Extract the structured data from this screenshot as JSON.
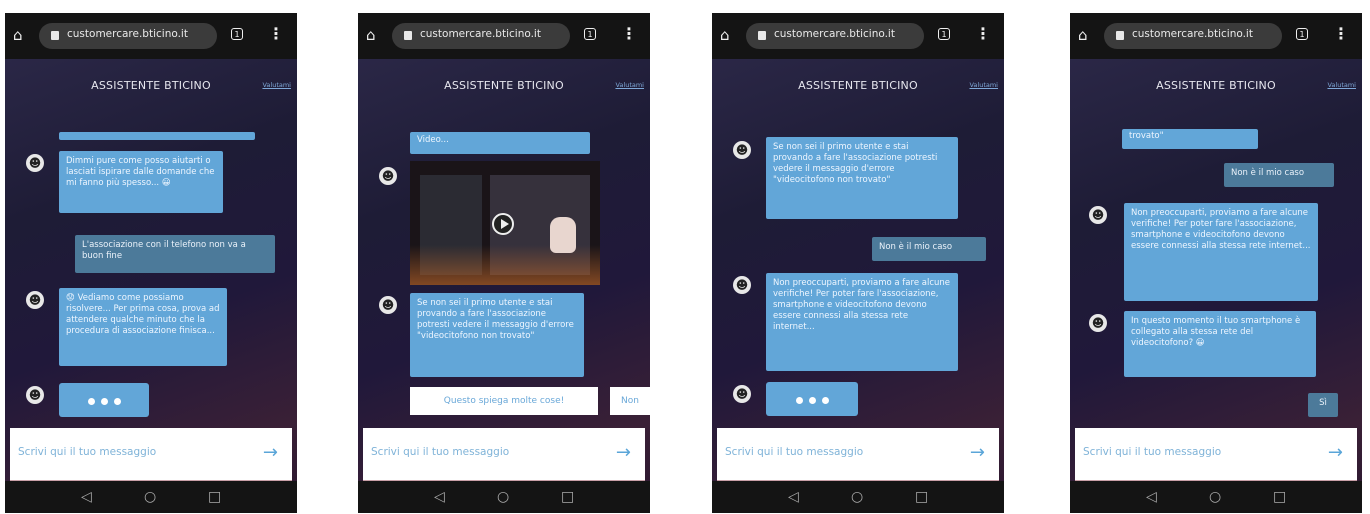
{
  "browser": {
    "url": "customercare.bticino.it",
    "tab_count": "1",
    "menu_icon": "⋮",
    "home_icon": "⌂"
  },
  "header": {
    "title": "ASSISTENTE BTICINO",
    "rate_link": "Valutami"
  },
  "composer": {
    "placeholder": "Scrivi qui il tuo messaggio",
    "send_icon": "→"
  },
  "navbar": {
    "back": "◁",
    "home": "○",
    "recents": "□"
  },
  "screens": [
    {
      "messages": [
        {
          "from": "bot",
          "text": "Dimmi pure come posso aiutarti o lasciati ispirare dalle domande che mi fanno più spesso... 😀"
        },
        {
          "from": "user",
          "text": "L'associazione con il telefono non va a buon fine"
        },
        {
          "from": "bot",
          "text": "😟 Vediamo come possiamo risolvere... Per prima cosa, prova ad attendere qualche minuto che la procedura di associazione finisca..."
        }
      ]
    },
    {
      "messages": [
        {
          "from": "bot",
          "text": "Video..."
        },
        {
          "from": "bot",
          "text": "Se non sei il primo utente e stai provando a fare l'associazione potresti vedere il messaggio d'errore \"videocitofono non trovato\""
        }
      ],
      "chips": [
        "Questo spiega molte cose!",
        "Non"
      ]
    },
    {
      "messages": [
        {
          "from": "bot",
          "text": "Se non sei il primo utente e stai provando a fare l'associazione potresti vedere il messaggio d'errore \"videocitofono non trovato\""
        },
        {
          "from": "user",
          "text": "Non è il mio caso"
        },
        {
          "from": "bot",
          "text": "Non preoccuparti, proviamo a fare alcune verifiche! Per poter fare l'associazione, smartphone e videocitofono devono essere connessi alla stessa rete internet..."
        }
      ]
    },
    {
      "messages": [
        {
          "from": "bot",
          "text": "trovato\""
        },
        {
          "from": "user",
          "text": "Non è il mio caso"
        },
        {
          "from": "bot",
          "text": "Non preoccuparti, proviamo a fare alcune verifiche! Per poter fare l'associazione, smartphone e videocitofono devono essere connessi alla stessa rete internet..."
        },
        {
          "from": "bot",
          "text": "In questo momento il tuo smartphone è collegato alla stessa rete del videocitofono? 😀"
        },
        {
          "from": "user",
          "text": "Sì"
        }
      ]
    }
  ]
}
